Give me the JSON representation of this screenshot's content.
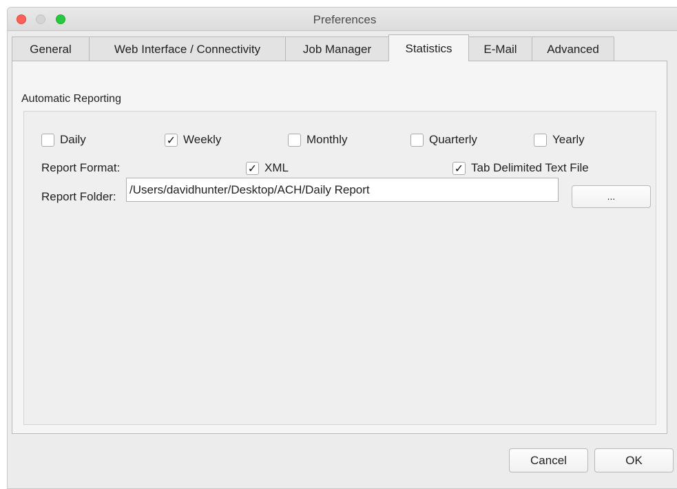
{
  "window": {
    "title": "Preferences"
  },
  "tabs": [
    {
      "label": "General"
    },
    {
      "label": "Web Interface / Connectivity"
    },
    {
      "label": "Job Manager"
    },
    {
      "label": "Statistics",
      "active": true
    },
    {
      "label": "E-Mail"
    },
    {
      "label": "Advanced"
    }
  ],
  "reporting": {
    "group_label": "Automatic Reporting",
    "periods": [
      {
        "label": "Daily",
        "checked": false
      },
      {
        "label": "Weekly",
        "checked": true
      },
      {
        "label": "Monthly",
        "checked": false
      },
      {
        "label": "Quarterly",
        "checked": false
      },
      {
        "label": "Yearly",
        "checked": false
      }
    ],
    "format_label": "Report Format:",
    "formats": [
      {
        "label": "XML",
        "checked": true
      },
      {
        "label": "Tab Delimited Text File",
        "checked": true
      }
    ],
    "folder_label": "Report Folder:",
    "folder_value": "/Users/davidhunter/Desktop/ACH/Daily Report",
    "browse_label": "..."
  },
  "buttons": {
    "cancel": "Cancel",
    "ok": "OK"
  },
  "check_mark": "✓"
}
